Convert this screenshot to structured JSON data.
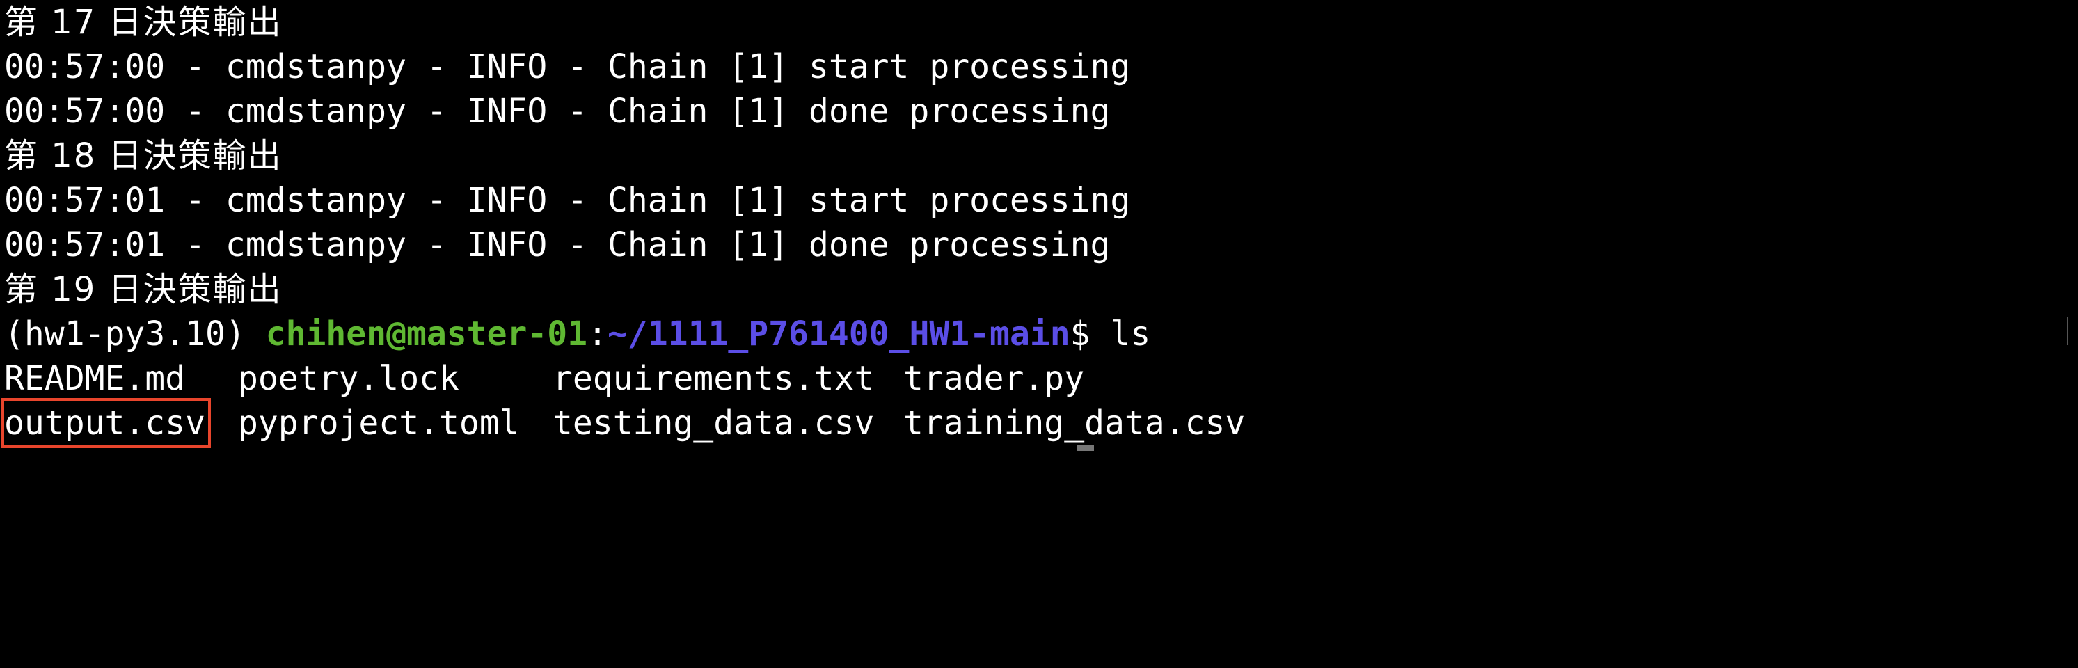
{
  "terminal": {
    "lines": [
      {
        "text": "第 17 日決策輸出"
      },
      {
        "text": "00:57:00 - cmdstanpy - INFO - Chain [1] start processing"
      },
      {
        "text": "00:57:00 - cmdstanpy - INFO - Chain [1] done processing"
      },
      {
        "text": "第 18 日決策輸出"
      },
      {
        "text": "00:57:01 - cmdstanpy - INFO - Chain [1] start processing"
      },
      {
        "text": "00:57:01 - cmdstanpy - INFO - Chain [1] done processing"
      },
      {
        "text": "第 19 日決策輸出"
      }
    ],
    "prompt": {
      "env": "(hw1-py3.10) ",
      "user_host": "chihen@master-01",
      "colon": ":",
      "path": "~/1111_P761400_HW1-main",
      "symbol": "$ ",
      "command": "ls"
    },
    "ls_output": {
      "row1": [
        "README.md",
        "poetry.lock",
        "requirements.txt",
        "trader.py"
      ],
      "row2": [
        "output.csv",
        "pyproject.toml",
        "testing_data.csv",
        "training_data.csv"
      ]
    },
    "highlighted_file": "output.csv",
    "colors": {
      "background": "#000000",
      "text": "#ffffff",
      "user_host": "#5fb832",
      "path": "#5b4ee6",
      "highlight_box": "#e8452c"
    }
  }
}
